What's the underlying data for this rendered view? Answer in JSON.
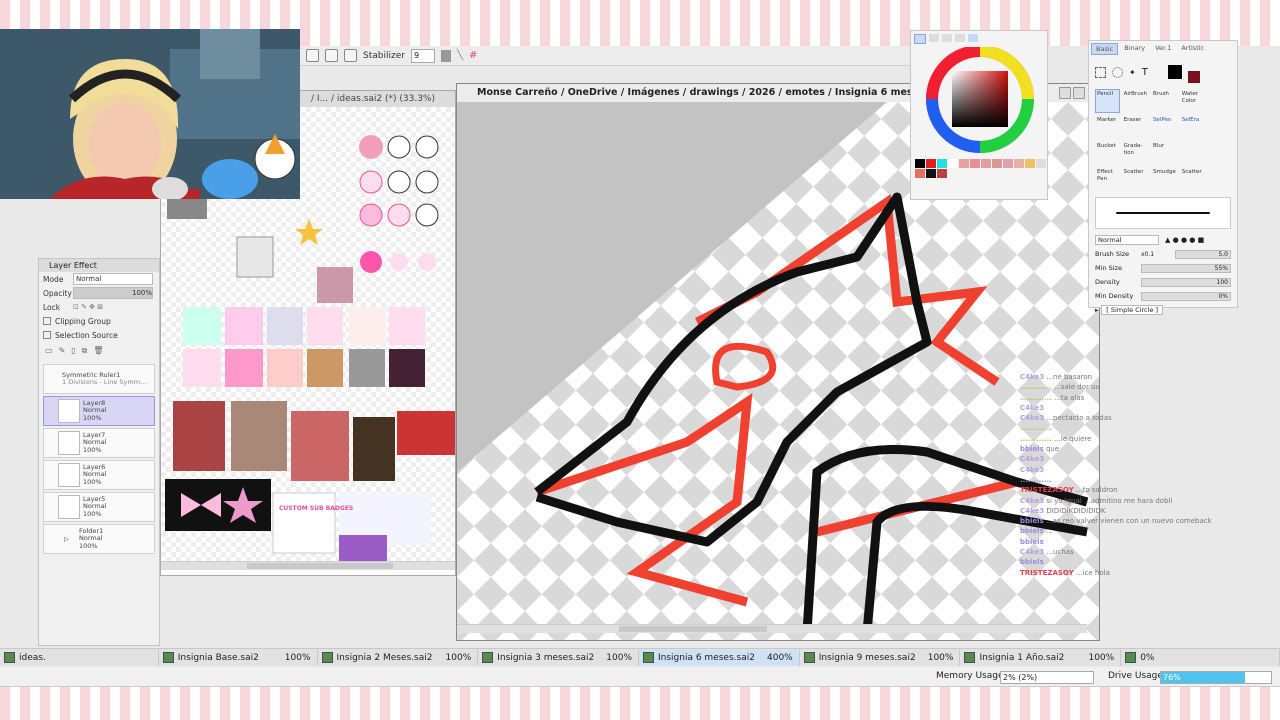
{
  "toolbar": {
    "stabilizer_label": "Stabilizer",
    "stabilizer_value": "9"
  },
  "ideas_window": {
    "title": "/ I... / ideas.sai2 (*) (33.3%)",
    "badge_text": "CUSTOM SUB BADGES"
  },
  "layer_panel": {
    "title": "Layer Effect",
    "mode_label": "Mode",
    "mode_value": "Normal",
    "opacity_label": "Opacity",
    "opacity_value": "100%",
    "lock_label": "Lock",
    "clipping_label": "Clipping Group",
    "selection_label": "Selection Source",
    "layers": [
      {
        "name": "Symmetric Ruler1",
        "detail": "1 Divisions - Line Symm..."
      },
      {
        "name": "Layer8",
        "mode": "Normal",
        "opacity": "100%"
      },
      {
        "name": "Layer7",
        "mode": "Normal",
        "opacity": "100%"
      },
      {
        "name": "Layer6",
        "mode": "Normal",
        "opacity": "100%"
      },
      {
        "name": "Layer5",
        "mode": "Normal",
        "opacity": "100%"
      },
      {
        "name": "Folder1",
        "mode": "Normal",
        "opacity": "100%"
      }
    ]
  },
  "main_doc": {
    "title": "Monse Carreño / OneDrive / Imágenes / drawings / 2026 / emotes / Insignia 6 meses.sai2 (*"
  },
  "tool_panel": {
    "tabs": [
      "Basic",
      "Binary",
      "Ver.1",
      "Artistic"
    ],
    "tools": [
      {
        "label": "Pencil",
        "active": true
      },
      {
        "label": "AirBrush"
      },
      {
        "label": "Brush"
      },
      {
        "label": "Water Color"
      },
      {
        "label": ""
      },
      {
        "label": "Marker"
      },
      {
        "label": "Eraser"
      },
      {
        "label": "SelPen",
        "blue": true
      },
      {
        "label": "SelEra",
        "blue": true
      },
      {
        "label": ""
      },
      {
        "label": "Bucket"
      },
      {
        "label": "Grada-tion"
      },
      {
        "label": "Blur"
      },
      {
        "label": ""
      },
      {
        "label": ""
      },
      {
        "label": "Effect Pen"
      },
      {
        "label": "Scatter"
      },
      {
        "label": "Smudge"
      },
      {
        "label": "Scatter"
      },
      {
        "label": ""
      }
    ],
    "blend_mode": "Normal",
    "brush_size_label": "Brush Size",
    "brush_size_mult": "x0.1",
    "brush_size_value": "5.0",
    "min_size_label": "Min Size",
    "min_size_value": "55%",
    "density_label": "Density",
    "density_value": "100",
    "min_density_label": "Min Density",
    "min_density_value": "0%",
    "shape_label": "[ Simple Circle ]"
  },
  "doc_tabs": [
    {
      "name": "ideas.",
      "zoom": ""
    },
    {
      "name": "Insignia Base.sai2",
      "zoom": "100%"
    },
    {
      "name": "Insignia 2 Meses.sai2",
      "zoom": "100%"
    },
    {
      "name": "Insignia 3 meses.sai2",
      "zoom": "100%"
    },
    {
      "name": "Insignia 6 meses.sai2",
      "zoom": "400%",
      "active": true
    },
    {
      "name": "Insignia 9 meses.sai2",
      "zoom": "100%"
    },
    {
      "name": "Insignia 1 Año.sai2",
      "zoom": "100%"
    },
    {
      "name": "0%",
      "zoom": ""
    }
  ],
  "status": {
    "memory_label": "Memory Usage",
    "memory_value": "2% (2%)",
    "drive_label": "Drive Usage",
    "drive_value": "76%",
    "drive_fraction": 0.76
  },
  "chat": [
    {
      "user": "C4ke3",
      "msg": "...ne basaron",
      "color": "#b4a0e0"
    },
    {
      "user": "............",
      "msg": "...sale dor uu",
      "color": "#a0c860"
    },
    {
      "user": "............",
      "msg": "...ta alas",
      "color": "#a0c860"
    },
    {
      "user": "C4ke3",
      "msg": "",
      "color": "#b4a0e0"
    },
    {
      "user": "C4ke3",
      "msg": "...pectacto a todas",
      "color": "#b4a0e0"
    },
    {
      "user": "............",
      "msg": "",
      "color": "#a0c860"
    },
    {
      "user": "............",
      "msg": "...le quiere",
      "color": "#a0c860"
    },
    {
      "user": "bbiels",
      "msg": "que",
      "color": "#9b8be0"
    },
    {
      "user": "C4ke3",
      "msg": "",
      "color": "#b4a0e0"
    },
    {
      "user": "C4ke3",
      "msg": "",
      "color": "#b4a0e0"
    },
    {
      "user": "............",
      "msg": "",
      "color": "#7aa0d0"
    },
    {
      "user": "TRISTEZASOY",
      "msg": "...to saldron",
      "color": "#e04050"
    },
    {
      "user": "C4ke3",
      "msg": "si yo igual ...admitino me hara dobli",
      "color": "#b4a0e0"
    },
    {
      "user": "C4ke3",
      "msg": "DIDIDIKDIDIDIDK",
      "color": "#b4a0e0"
    },
    {
      "user": "bbiels",
      "msg": "...as reo valver vienen con un nuevo comeback",
      "color": "#9b8be0"
    },
    {
      "user": "bbiels",
      "msg": "...",
      "color": "#9b8be0"
    },
    {
      "user": "bbiels",
      "msg": "",
      "color": "#9b8be0"
    },
    {
      "user": "C4ke3",
      "msg": "...uchas",
      "color": "#b4a0e0"
    },
    {
      "user": "bbiels",
      "msg": "",
      "color": "#9b8be0"
    },
    {
      "user": "TRISTEZASOY",
      "msg": "...ice hola",
      "color": "#e04050"
    }
  ]
}
